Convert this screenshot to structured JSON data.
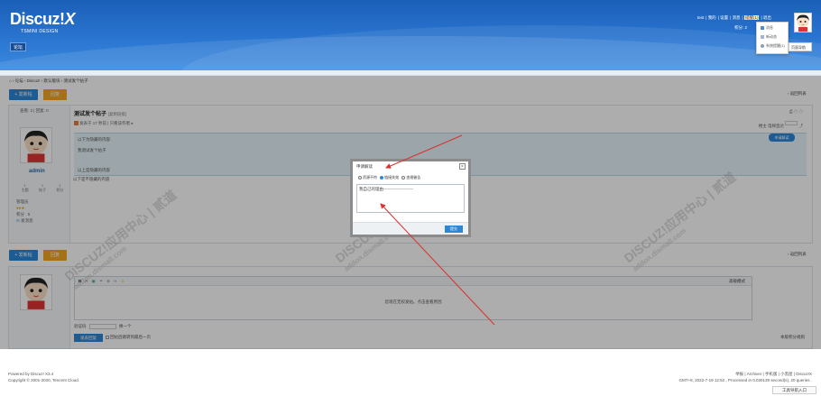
{
  "header": {
    "brand_main": "Discuz!",
    "brand_x": "X",
    "brand_sub": "TSMINI DESIGN",
    "nav_forum": "论坛",
    "userbar": [
      "test",
      "我的",
      "设置",
      "消息",
      "提醒(1)",
      "退出"
    ],
    "credit_line": "积分: 2",
    "dropdown": [
      "消息",
      "新动态",
      "系统提醒(1)"
    ],
    "dropdown_extra": "页面导航"
  },
  "breadcrumb": [
    "论坛",
    "Discuz!",
    "默认版块",
    "测试发个帖子"
  ],
  "toolbar": {
    "new_post": "+ 发新帖",
    "reply": "回复",
    "return_list": "返回列表"
  },
  "post": {
    "stats": "查看: 2 | 回复: 0",
    "title": "测试发个帖子",
    "title_tag": "[复制链接]",
    "meta": "发表于 17 秒前 | 只看该作者",
    "right_meta": "楼主  电梯直达",
    "hidden_label": "以下为隐藏的内容:",
    "hidden_content": "我测试发个帖子",
    "hidden_footer": "以上是隐藏的内容",
    "below_hidden": "以下是不隐藏的内容",
    "apply_button": "申请解读"
  },
  "author": {
    "name": "admin",
    "stats_values": [
      "1",
      "1",
      "1"
    ],
    "stats_labels": [
      "主题",
      "帖子",
      "积分"
    ],
    "group": "管理员",
    "credit_label": "积分",
    "credit_value": "5",
    "send_msg": "发消息"
  },
  "reply_box": {
    "advanced": "高级模式",
    "editor_message": "您现在无权发帖。点击查看原因",
    "captcha_label": "验证码",
    "captcha_refresh": "换一个",
    "submit": "发表回复",
    "checkbox_label": "回帖后跳转到最后一页",
    "credit_rule": "本版积分规则"
  },
  "dialog": {
    "title": "申请解读",
    "close": "×",
    "radio_options": [
      "资源不符",
      "链接失效",
      "违规催告"
    ],
    "textarea_value": "我自己的理由----------------------",
    "submit": "提交"
  },
  "footer": {
    "powered": "Powered by Discuz! X3.4",
    "copyright": "Copyright © 2001-2020, Tencent Cloud.",
    "links": "举报 | Archiver | 手机版 | 小黑屋 | Discuz!X",
    "timing": "GMT+8, 2022-7-19 12:52 , Processed in 0.030139 second(s), 20 queries .",
    "fav": "工具导航入口"
  },
  "watermark": {
    "main": "DISCUZ!应用中心 | 贰道",
    "url": "addon.dismall.com"
  },
  "colors": {
    "header_top": "#1b5fb8",
    "accent_blue": "#2b88d9",
    "accent_orange": "#f5a623",
    "arrow_red": "#d9312b"
  }
}
